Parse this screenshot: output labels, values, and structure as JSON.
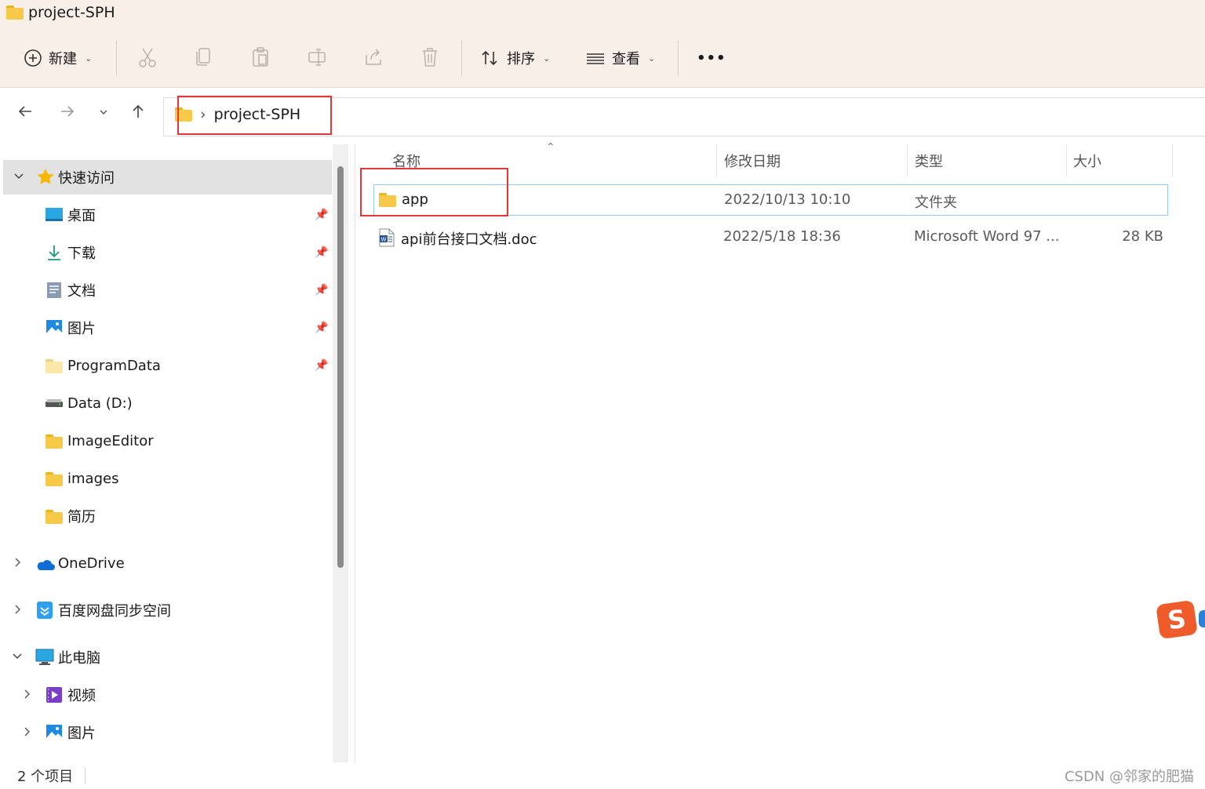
{
  "window": {
    "title": "project-SPH"
  },
  "toolbar": {
    "new_label": "新建",
    "sort_label": "排序",
    "view_label": "查看",
    "more_label": "•••"
  },
  "address": {
    "separator": "›",
    "current": "project-SPH"
  },
  "sidebar": {
    "quick_access": "快速访问",
    "items": [
      {
        "label": "桌面",
        "icon": "desktop-icon"
      },
      {
        "label": "下载",
        "icon": "download-icon"
      },
      {
        "label": "文档",
        "icon": "document-icon"
      },
      {
        "label": "图片",
        "icon": "picture-icon"
      },
      {
        "label": "ProgramData",
        "icon": "folder-icon"
      },
      {
        "label": "Data (D:)",
        "icon": "drive-icon"
      },
      {
        "label": "ImageEditor",
        "icon": "folder-icon"
      },
      {
        "label": "images",
        "icon": "folder-icon"
      },
      {
        "label": "简历",
        "icon": "folder-icon"
      }
    ],
    "onedrive": "OneDrive",
    "baidu": "百度网盘同步空间",
    "this_pc": "此电脑",
    "pc_items": [
      {
        "label": "视频",
        "icon": "video-icon"
      },
      {
        "label": "图片",
        "icon": "picture-icon"
      }
    ]
  },
  "columns": {
    "name": "名称",
    "modified": "修改日期",
    "type": "类型",
    "size": "大小"
  },
  "files": [
    {
      "name": "app",
      "modified": "2022/10/13 10:10",
      "type": "文件夹",
      "size": ""
    },
    {
      "name": "api前台接口文档.doc",
      "modified": "2022/5/18 18:36",
      "type": "Microsoft Word 97 ...",
      "size": "28 KB"
    }
  ],
  "status": {
    "count": "2 个项目"
  },
  "watermark": "CSDN @邻家的肥猫",
  "colors": {
    "highlight_box": "#e5363b",
    "selection_border": "#99c9ea",
    "folder": "#f7c948"
  }
}
